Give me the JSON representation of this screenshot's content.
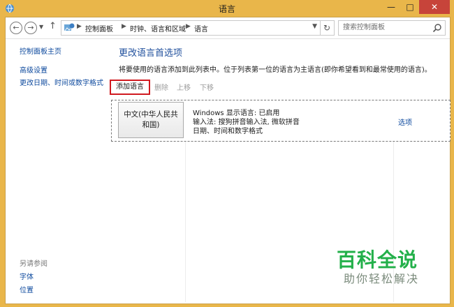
{
  "window": {
    "title": "语言",
    "minimize": "—",
    "maximize": "□",
    "close": "✕"
  },
  "address": {
    "crumbs": [
      "控制面板",
      "时钟、语言和区域",
      "语言"
    ],
    "search_placeholder": "搜索控制面板"
  },
  "sidebar": {
    "home": "控制面板主页",
    "links": [
      "高级设置",
      "更改日期、时间或数字格式"
    ],
    "see_also_title": "另请参阅",
    "see_also": [
      "字体",
      "位置"
    ]
  },
  "main": {
    "heading": "更改语言首选项",
    "description": "将要使用的语言添加到此列表中。位于列表第一位的语言为主语言(即你希望看到和最常使用的语言)。",
    "toolbar": {
      "add": "添加语言",
      "remove": "删除",
      "up": "上移",
      "down": "下移"
    },
    "languages": [
      {
        "name_line1": "中文(中华人民共",
        "name_line2": "和国)",
        "display_language": "Windows 显示语言: 已启用",
        "input_method": "输入法: 搜狗拼音输入法, 微软拼音",
        "formats": "日期、时间和数字格式",
        "options": "选项"
      }
    ]
  },
  "watermark": {
    "logo": "百科全说",
    "sub": "助你轻松解决"
  }
}
